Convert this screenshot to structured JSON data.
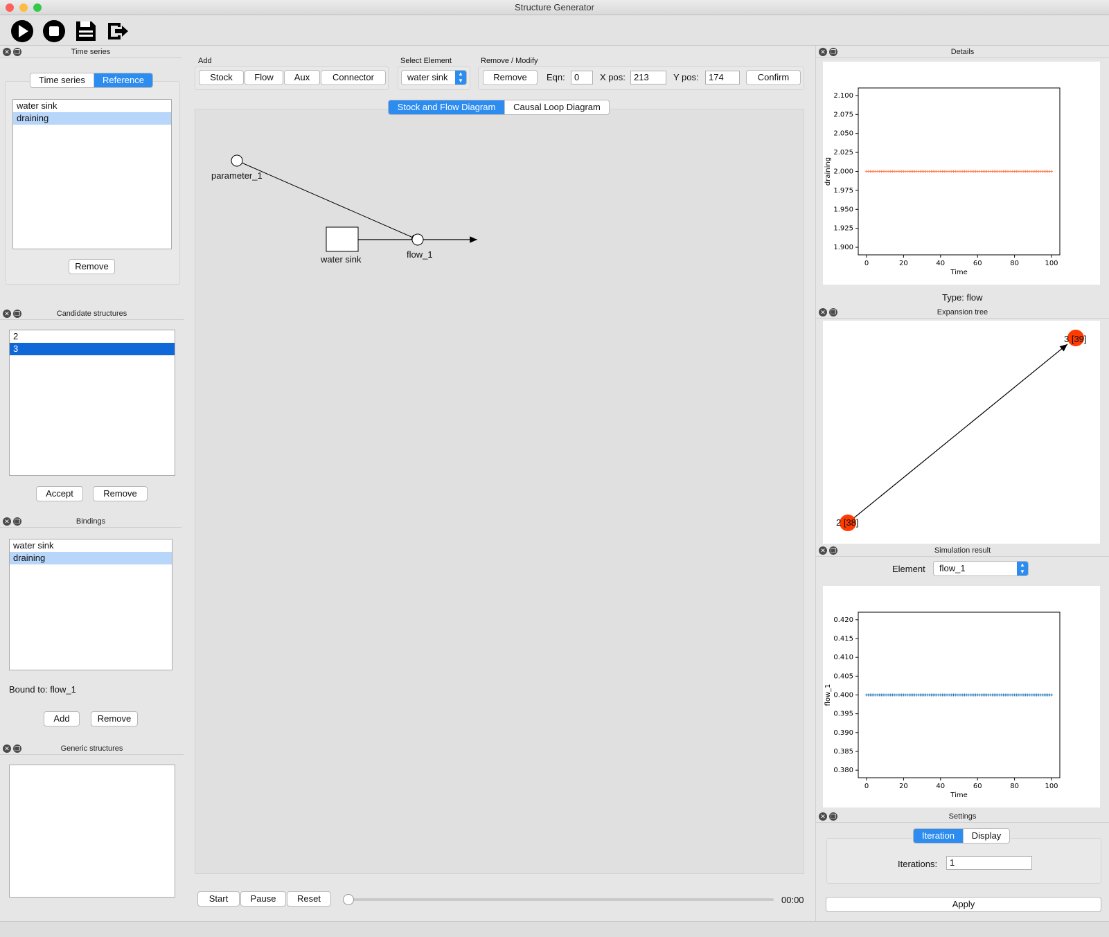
{
  "window": {
    "title": "Structure Generator"
  },
  "toolbar": {
    "icons": [
      "play-icon",
      "stop-icon",
      "save-icon",
      "exit-icon"
    ]
  },
  "time_series_panel": {
    "title": "Time series",
    "tabs": [
      "Time series",
      "Reference"
    ],
    "active_tab": "Reference",
    "items": [
      "water sink",
      "draining"
    ],
    "selected": "draining",
    "remove_label": "Remove"
  },
  "candidate_panel": {
    "title": "Candidate structures",
    "items": [
      "2",
      "3"
    ],
    "selected": "3",
    "accept_label": "Accept",
    "remove_label": "Remove"
  },
  "bindings_panel": {
    "title": "Bindings",
    "items": [
      "water sink",
      "draining"
    ],
    "selected": "draining",
    "bound_to": "Bound to: flow_1",
    "add_label": "Add",
    "remove_label": "Remove"
  },
  "generic_panel": {
    "title": "Generic structures"
  },
  "add_group": {
    "label": "Add",
    "buttons": [
      "Stock",
      "Flow",
      "Aux",
      "Connector"
    ]
  },
  "select_group": {
    "label": "Select Element",
    "value": "water sink"
  },
  "modify_group": {
    "label": "Remove / Modify",
    "remove_label": "Remove",
    "eqn_label": "Eqn:",
    "eqn_value": "0",
    "xpos_label": "X pos:",
    "xpos_value": "213",
    "ypos_label": "Y pos:",
    "ypos_value": "174",
    "confirm_label": "Confirm"
  },
  "diagram_tabs": [
    "Stock and Flow Diagram",
    "Causal Loop Diagram"
  ],
  "diagram": {
    "parameter_label": "parameter_1",
    "stock_label": "water sink",
    "flow_label": "flow_1"
  },
  "playback": {
    "start_label": "Start",
    "pause_label": "Pause",
    "reset_label": "Reset",
    "time": "00:00"
  },
  "details_panel": {
    "title": "Details",
    "type_label": "Type: flow"
  },
  "expansion_panel": {
    "title": "Expansion tree",
    "nodes": [
      {
        "label": "2 [38]"
      },
      {
        "label": "3 [39]"
      }
    ],
    "node_color": "#ff3b00"
  },
  "simulation_panel": {
    "title": "Simulation result",
    "element_label": "Element",
    "element_value": "flow_1"
  },
  "settings_panel": {
    "title": "Settings",
    "tabs": [
      "Iteration",
      "Display"
    ],
    "active_tab": "Iteration",
    "iterations_label": "Iterations:",
    "iterations_value": "1",
    "apply_label": "Apply"
  },
  "chart_data": [
    {
      "type": "scatter",
      "xlabel": "Time",
      "ylabel": "draining",
      "x_range": [
        0,
        100
      ],
      "xticks": [
        "0",
        "20",
        "40",
        "60",
        "80",
        "100"
      ],
      "ylim": [
        1.89,
        2.11
      ],
      "yticks": [
        "1.900",
        "1.925",
        "1.950",
        "1.975",
        "2.000",
        "2.025",
        "2.050",
        "2.075",
        "2.100"
      ],
      "series": [
        {
          "y_constant": 2.0,
          "color": "#ff7f50"
        }
      ]
    },
    {
      "type": "scatter",
      "xlabel": "Time",
      "ylabel": "flow_1",
      "x_range": [
        0,
        100
      ],
      "xticks": [
        "0",
        "20",
        "40",
        "60",
        "80",
        "100"
      ],
      "ylim": [
        0.378,
        0.422
      ],
      "yticks": [
        "0.380",
        "0.385",
        "0.390",
        "0.395",
        "0.400",
        "0.405",
        "0.410",
        "0.415",
        "0.420"
      ],
      "series": [
        {
          "y_constant": 0.4,
          "color": "#1f77b4"
        }
      ]
    }
  ]
}
